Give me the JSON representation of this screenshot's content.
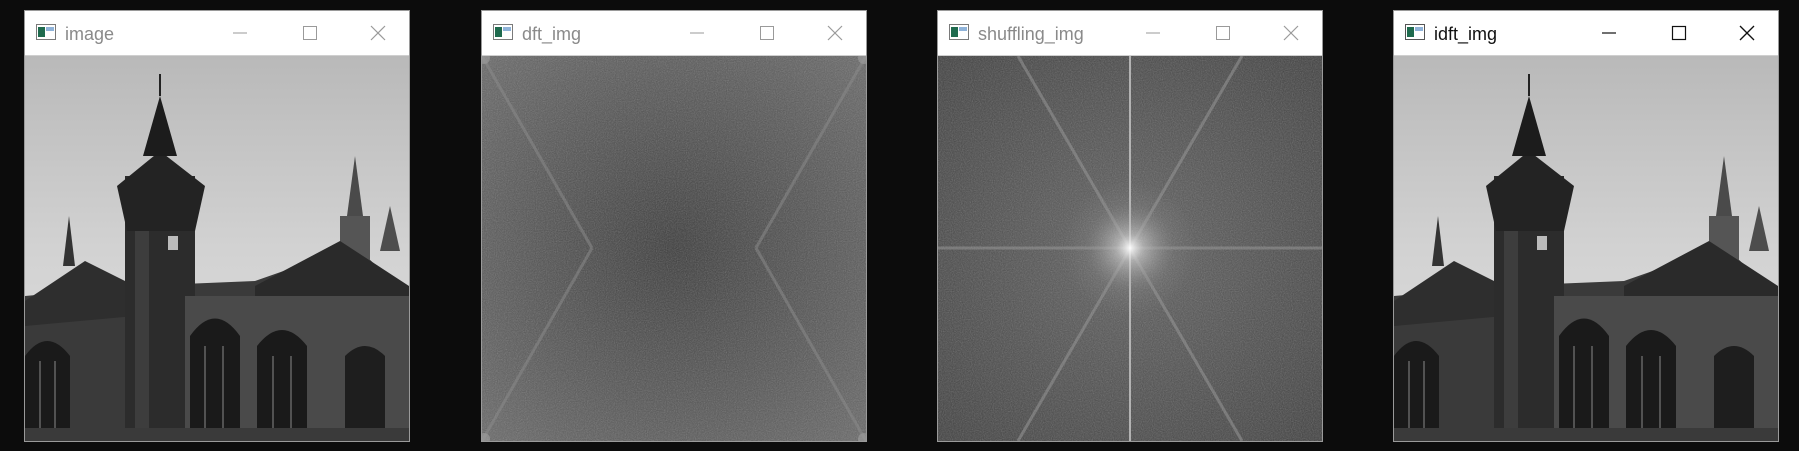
{
  "windows": [
    {
      "title": "image",
      "content": "grayscale photo of a gothic church with tower",
      "active": false
    },
    {
      "title": "dft_img",
      "content": "DFT magnitude spectrum (unshifted)",
      "active": false
    },
    {
      "title": "shuffling_img",
      "content": "shifted DFT magnitude spectrum",
      "active": false
    },
    {
      "title": "idft_img",
      "content": "inverse DFT reconstructed photo",
      "active": true
    }
  ],
  "icons": {
    "app": "window-app-icon",
    "minimize": "minimize-icon",
    "maximize": "maximize-icon",
    "close": "close-icon"
  },
  "colors": {
    "desktop": "#0c0c0c",
    "titlebar": "#ffffff",
    "inactive_title": "#8a8a8a",
    "active_title": "#111111"
  }
}
